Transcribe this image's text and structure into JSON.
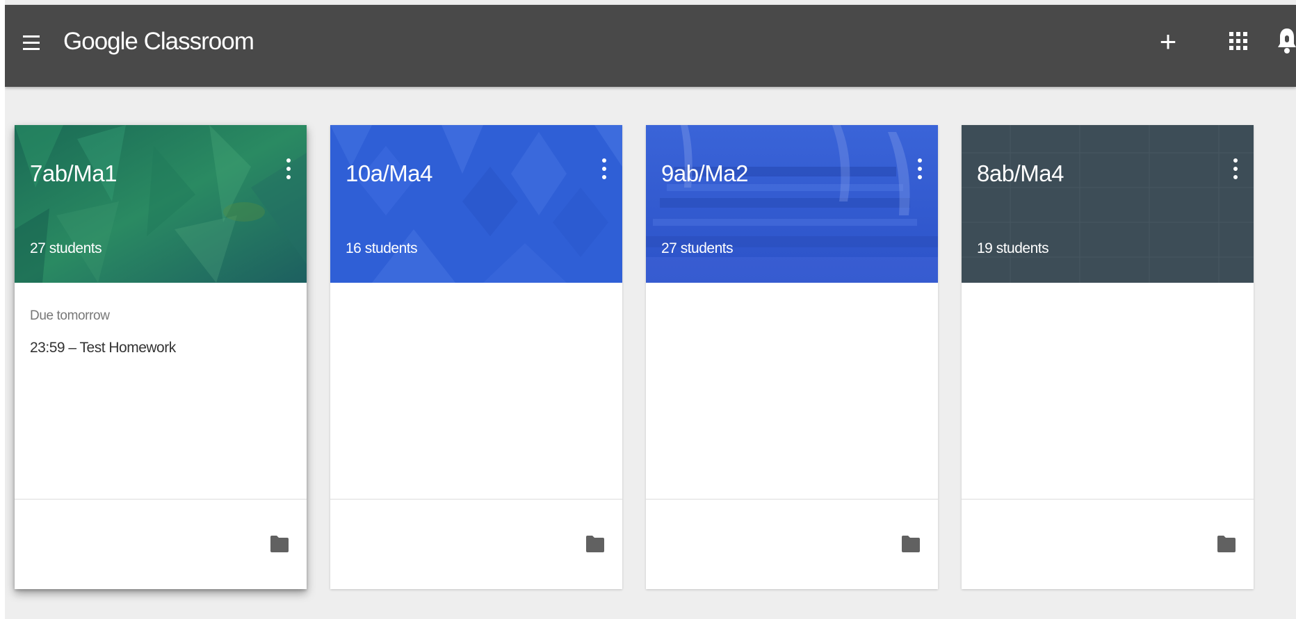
{
  "appbar": {
    "title": "Google Classroom",
    "menu_icon": "hamburger-menu-icon",
    "add_icon": "plus-icon",
    "add_label": "+",
    "apps_icon": "apps-grid-icon",
    "notifications_icon": "notifications-icon",
    "background_color": "#494949"
  },
  "classes": [
    {
      "name": "7ab/Ma1",
      "students": "27 students",
      "theme_color": "#1f7a5c",
      "due_label": "Due tomorrow",
      "due_item": "23:59 – Test Homework",
      "more_icon": "more-vert-icon",
      "folder_icon": "folder-icon"
    },
    {
      "name": "10a/Ma4",
      "students": "16 students",
      "theme_color": "#2f5fd6",
      "more_icon": "more-vert-icon",
      "folder_icon": "folder-icon"
    },
    {
      "name": "9ab/Ma2",
      "students": "27 students",
      "theme_color": "#2f5ad6",
      "more_icon": "more-vert-icon",
      "folder_icon": "folder-icon"
    },
    {
      "name": "8ab/Ma4",
      "students": "19 students",
      "theme_color": "#3a4a55",
      "more_icon": "more-vert-icon",
      "folder_icon": "folder-icon"
    }
  ]
}
